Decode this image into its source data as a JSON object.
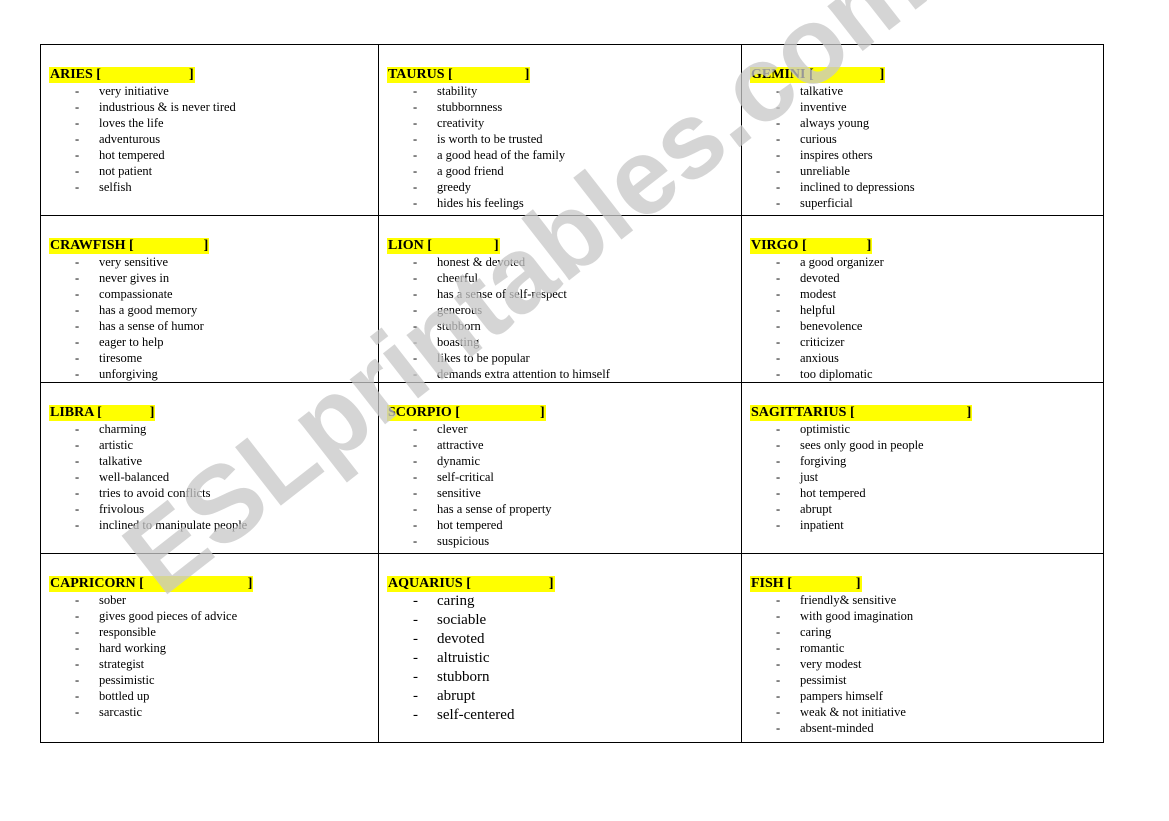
{
  "watermark": "ESLprintables.com",
  "bullet": "-",
  "signs": [
    {
      "name": "ARIES",
      "blank_width": "          ",
      "traits": [
        "very initiative",
        "industrious & is never tired",
        "loves the life",
        "adventurous",
        "hot tempered",
        "not patient",
        "selfish"
      ]
    },
    {
      "name": "TAURUS",
      "traits": [
        "stability",
        "stubbornness",
        "creativity",
        "is worth to be trusted",
        "a good head of the family",
        "a good friend",
        "greedy",
        "hides his feelings"
      ]
    },
    {
      "name": "GEMINI",
      "traits": [
        "talkative",
        "inventive",
        "always young",
        "curious",
        "inspires others",
        "unreliable",
        "inclined to depressions",
        "superficial"
      ]
    },
    {
      "name": "CRAWFISH",
      "traits": [
        "very sensitive",
        "never gives in",
        "compassionate",
        "has a good memory",
        "has a sense of humor",
        "eager to help",
        "tiresome",
        "unforgiving"
      ]
    },
    {
      "name": "LION",
      "traits": [
        "honest & devoted",
        "cheerful",
        "has a sense of self-respect",
        "generous",
        "stubborn",
        "boasting",
        "likes to be popular",
        "demands extra attention to himself"
      ]
    },
    {
      "name": "VIRGO",
      "traits": [
        "a good organizer",
        "devoted",
        "modest",
        "helpful",
        "benevolence",
        "criticizer",
        "anxious",
        "too diplomatic"
      ]
    },
    {
      "name": "LIBRA",
      "traits": [
        "charming",
        "artistic",
        "talkative",
        "well-balanced",
        "tries to avoid conflicts",
        "frivolous",
        "inclined to manipulate people"
      ]
    },
    {
      "name": "SCORPIO",
      "traits": [
        "clever",
        "attractive",
        "dynamic",
        "self-critical",
        "sensitive",
        "has a sense of property",
        "hot tempered",
        "suspicious"
      ]
    },
    {
      "name": "SAGITTARIUS",
      "traits": [
        "optimistic",
        "sees only good in people",
        "forgiving",
        "just",
        "hot tempered",
        "abrupt",
        "inpatient"
      ]
    },
    {
      "name": "CAPRICORN",
      "traits": [
        "sober",
        "gives good pieces of advice",
        "responsible",
        "hard working",
        "strategist",
        "pessimistic",
        "bottled up",
        "sarcastic"
      ]
    },
    {
      "name": "AQUARIUS",
      "traits": [
        "caring",
        "sociable",
        "devoted",
        "altruistic",
        "stubborn",
        "abrupt",
        "self-centered"
      ]
    },
    {
      "name": "FISH",
      "traits": [
        "friendly& sensitive",
        "with good imagination",
        "caring",
        "romantic",
        "very modest",
        "pessimist",
        "pampers himself",
        "weak & not initiative",
        "absent-minded"
      ]
    }
  ]
}
